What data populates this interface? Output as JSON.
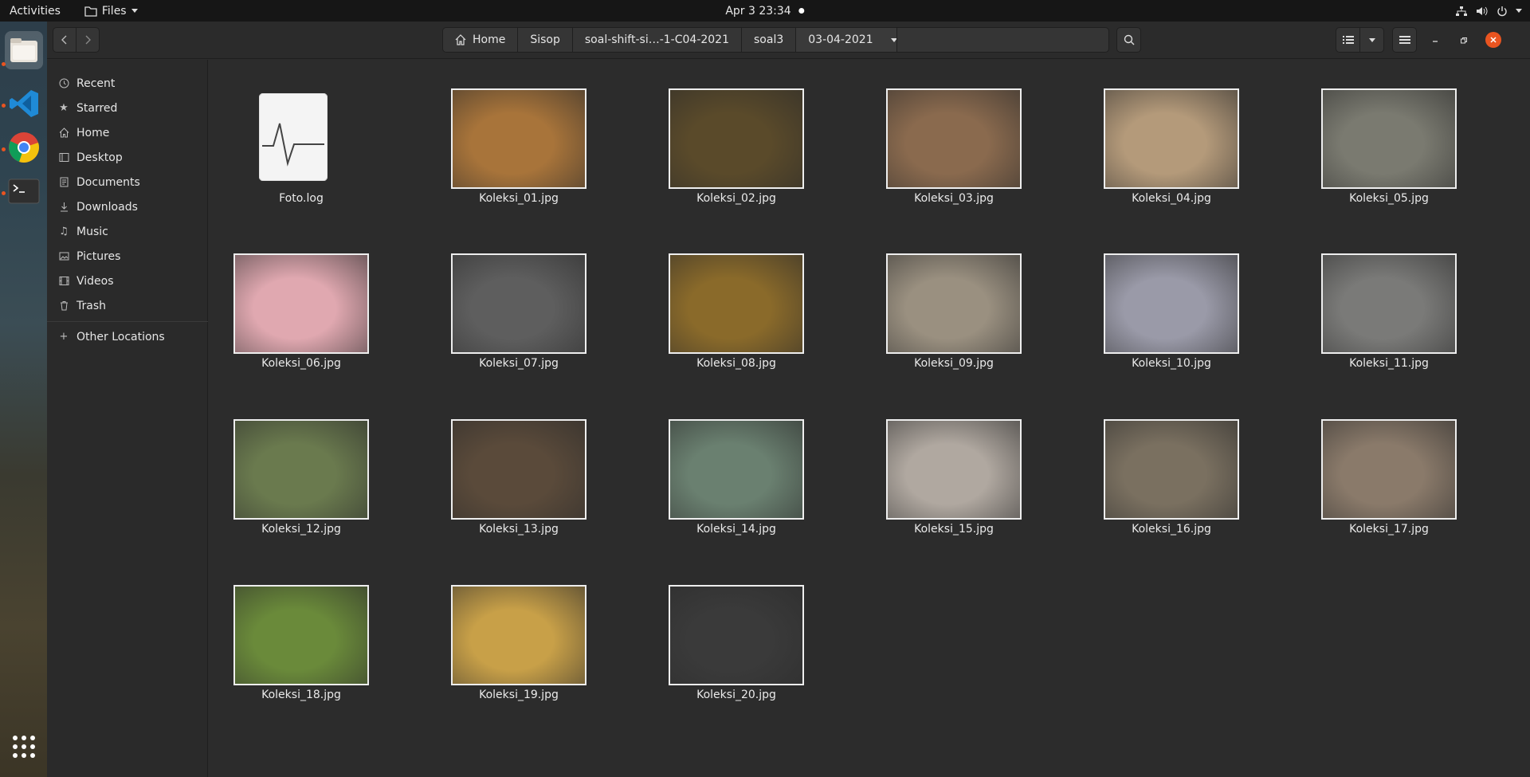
{
  "topbar": {
    "activities": "Activities",
    "app_name": "Files",
    "clock": "Apr 3  23:34"
  },
  "dock": {
    "items": [
      "files-icon",
      "vscode-icon",
      "chrome-icon",
      "terminal-icon"
    ],
    "app_grid": "apps-grid-icon"
  },
  "pathbar": {
    "crumbs": [
      "Home",
      "Sisop",
      "soal-shift-si…-1-C04-2021",
      "soal3",
      "03-04-2021"
    ]
  },
  "sidebar": {
    "items": [
      {
        "label": "Recent",
        "icon": "clock-icon"
      },
      {
        "label": "Starred",
        "icon": "star-icon"
      },
      {
        "label": "Home",
        "icon": "home-icon"
      },
      {
        "label": "Desktop",
        "icon": "desktop-icon"
      },
      {
        "label": "Documents",
        "icon": "documents-icon"
      },
      {
        "label": "Downloads",
        "icon": "downloads-icon"
      },
      {
        "label": "Music",
        "icon": "music-icon"
      },
      {
        "label": "Pictures",
        "icon": "pictures-icon"
      },
      {
        "label": "Videos",
        "icon": "videos-icon"
      },
      {
        "label": "Trash",
        "icon": "trash-icon"
      }
    ],
    "other_locations": "Other Locations"
  },
  "files": [
    {
      "name": "Foto.log",
      "kind": "log"
    },
    {
      "name": "Koleksi_01.jpg",
      "kind": "image",
      "color": "#a8743a"
    },
    {
      "name": "Koleksi_02.jpg",
      "kind": "image",
      "color": "#5a4a2a"
    },
    {
      "name": "Koleksi_03.jpg",
      "kind": "image",
      "color": "#8a6a4e"
    },
    {
      "name": "Koleksi_04.jpg",
      "kind": "image",
      "color": "#b49a7a"
    },
    {
      "name": "Koleksi_05.jpg",
      "kind": "image",
      "color": "#7a7a70"
    },
    {
      "name": "Koleksi_06.jpg",
      "kind": "image",
      "color": "#e0a8b0"
    },
    {
      "name": "Koleksi_07.jpg",
      "kind": "image",
      "color": "#5e5e5e"
    },
    {
      "name": "Koleksi_08.jpg",
      "kind": "image",
      "color": "#8a6a2a"
    },
    {
      "name": "Koleksi_09.jpg",
      "kind": "image",
      "color": "#9a9080"
    },
    {
      "name": "Koleksi_10.jpg",
      "kind": "image",
      "color": "#9a9aa8"
    },
    {
      "name": "Koleksi_11.jpg",
      "kind": "image",
      "color": "#7a7a78"
    },
    {
      "name": "Koleksi_12.jpg",
      "kind": "image",
      "color": "#6a7a4e"
    },
    {
      "name": "Koleksi_13.jpg",
      "kind": "image",
      "color": "#5a4a3a"
    },
    {
      "name": "Koleksi_14.jpg",
      "kind": "image",
      "color": "#6a8070"
    },
    {
      "name": "Koleksi_15.jpg",
      "kind": "image",
      "color": "#b0a8a0"
    },
    {
      "name": "Koleksi_16.jpg",
      "kind": "image",
      "color": "#7a7060"
    },
    {
      "name": "Koleksi_17.jpg",
      "kind": "image",
      "color": "#8a7a6a"
    },
    {
      "name": "Koleksi_18.jpg",
      "kind": "image",
      "color": "#6a8a3a"
    },
    {
      "name": "Koleksi_19.jpg",
      "kind": "image",
      "color": "#c8a048"
    },
    {
      "name": "Koleksi_20.jpg",
      "kind": "image",
      "color": "#3a3a3a"
    }
  ],
  "colors": {
    "accent": "#e95420",
    "window_bg": "#2c2c2c",
    "sidebar_bg": "#2a2a2a",
    "close_button": "#e95420"
  }
}
